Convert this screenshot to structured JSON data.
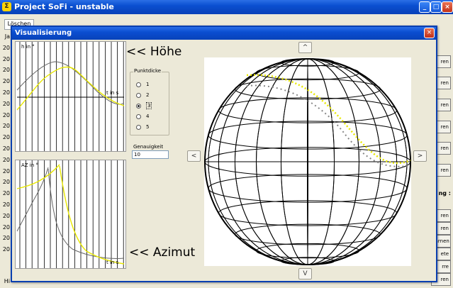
{
  "app": {
    "title": "Project SoFi - unstable",
    "icon": "sofi-app-icon"
  },
  "window_buttons": {
    "minimize": "_",
    "maximize": "□",
    "close": "×"
  },
  "main": {
    "tab_label": "Löschen",
    "row_labels": [
      "Ja",
      "20",
      "20",
      "20",
      "20",
      "20",
      "20",
      "20",
      "20",
      "20",
      "20",
      "20",
      "20",
      "20",
      "20",
      "20",
      "20",
      "20",
      "20",
      "20",
      "Hi"
    ],
    "right_buttons": [
      "ren",
      "ren",
      "ren",
      "ren",
      "ren",
      "ren",
      "ren",
      "ren",
      "ührnen",
      "ete",
      "rre",
      "ren"
    ],
    "right_label": "ng :"
  },
  "dialog": {
    "title": "Visualisierung",
    "close": "×",
    "labels": {
      "hoehe": "<< Höhe",
      "azimut": "<< Azimut"
    },
    "plot_top": {
      "ylabel": "h in °",
      "xlabel": "t in s"
    },
    "plot_bottom": {
      "ylabel": "AZ in °",
      "xlabel": "t in s"
    },
    "punktdicke": {
      "legend": "Punktdicke",
      "options": [
        "1",
        "2",
        "3",
        "4",
        "5"
      ],
      "selected": "3"
    },
    "genauigkeit": {
      "label": "Genauigkeit",
      "value": "10"
    },
    "nav": {
      "up": "^",
      "down": "V",
      "left": "<",
      "right": ">"
    },
    "colors": {
      "title_blue": "#0b4ed1",
      "track_yellow": "#e8e800",
      "track_gray": "#888888",
      "sphere_black": "#000000"
    }
  }
}
